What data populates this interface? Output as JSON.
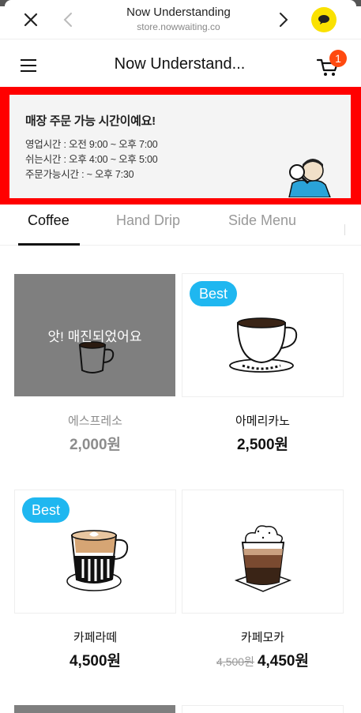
{
  "browser": {
    "title": "Now Understanding",
    "url": "store.nowwaiting.co"
  },
  "header": {
    "title": "Now Understand...",
    "cart_count": "1"
  },
  "banner": {
    "headline": "매장 주문 가능 시간이예요!",
    "lines": [
      "영업시간 : 오전 9:00 ~ 오후 7:00",
      "쉬는시간 : 오후 4:00 ~ 오후 5:00",
      "주문가능시간 : ~ 오후 7:30"
    ]
  },
  "tabs": [
    {
      "label": "Coffee",
      "active": true
    },
    {
      "label": "Hand Drip",
      "active": false
    },
    {
      "label": "Side Menu",
      "active": false
    }
  ],
  "products": [
    {
      "name": "에스프레소",
      "price": "2,000원",
      "sold_out": true,
      "sold_out_text": "앗! 매진되었어요"
    },
    {
      "name": "아메리카노",
      "price": "2,500원",
      "badge": "Best"
    },
    {
      "name": "카페라떼",
      "price": "4,500원",
      "badge": "Best"
    },
    {
      "name": "카페모카",
      "original_price": "4,500원",
      "price": "4,450원"
    }
  ],
  "colors": {
    "badge": "#1fb7f0",
    "cart_badge": "#ff4a10",
    "banner_outline": "#ff0000",
    "kakao": "#fae100"
  }
}
